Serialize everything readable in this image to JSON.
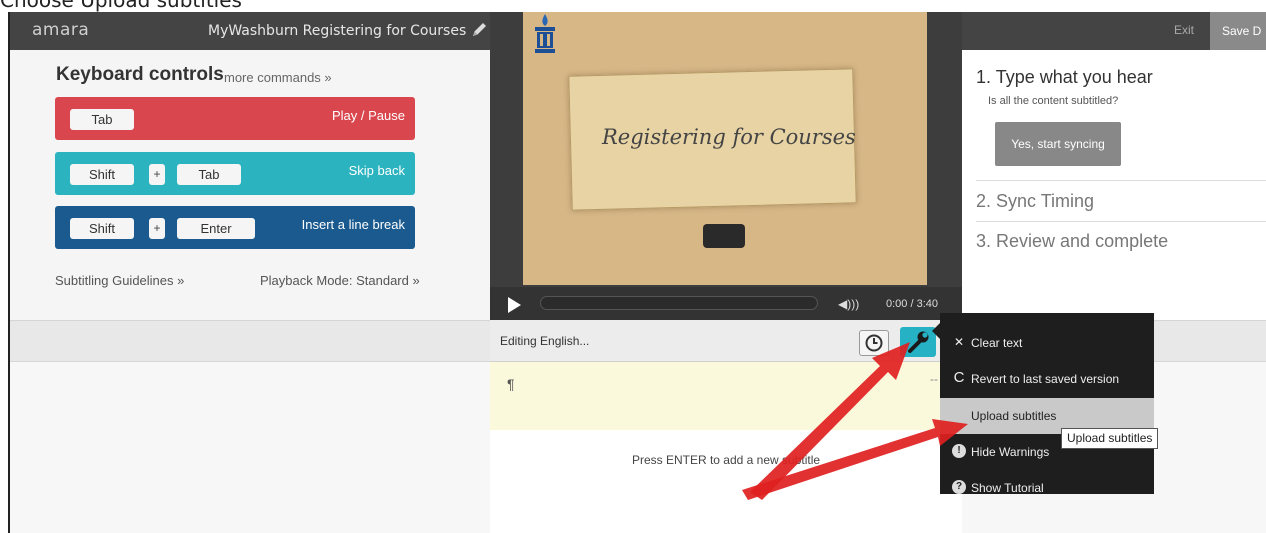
{
  "caption": "Choose Upload subtitles",
  "header": {
    "logo": "amara",
    "project_title": "MyWashburn Registering for Courses",
    "exit_label": "Exit",
    "save_label": "Save D"
  },
  "keyboard": {
    "title": "Keyboard controls",
    "more_link": "more commands »",
    "rows": [
      {
        "keys": [
          "Tab"
        ],
        "action": "Play / Pause"
      },
      {
        "keys": [
          "Shift",
          "+",
          "Tab"
        ],
        "action": "Skip back"
      },
      {
        "keys": [
          "Shift",
          "+",
          "Enter"
        ],
        "action": "Insert a line break"
      }
    ],
    "guidelines_link": "Subtitling Guidelines »",
    "playback_link": "Playback Mode: Standard »"
  },
  "video": {
    "slide_title": "Registering for Courses",
    "time": "0:00 / 3:40",
    "progress_fraction": 0
  },
  "steps": {
    "step1_title": "1. Type what you hear",
    "step1_question": "Is all the content subtitled?",
    "step1_button": "Yes, start syncing",
    "step2_title": "2. Sync Timing",
    "step3_title": "3. Review and complete"
  },
  "editor": {
    "editing_label": "Editing English...",
    "pilcrow": "¶",
    "row_dash": "--",
    "hint": "Press ENTER to add a new subtitle"
  },
  "menu": {
    "items": [
      {
        "icon": "close-icon",
        "glyph": "✕",
        "label": "Clear text"
      },
      {
        "icon": "revert-icon",
        "glyph": "C",
        "label": "Revert to last saved version"
      },
      {
        "icon": "",
        "glyph": "",
        "label": "Upload subtitles"
      },
      {
        "icon": "warning-icon",
        "glyph": "!",
        "label": "Hide Warnings"
      },
      {
        "icon": "help-icon",
        "glyph": "?",
        "label": "Show Tutorial"
      }
    ],
    "tooltip": "Upload subtitles"
  },
  "colors": {
    "play_pause": "#d9464e",
    "skip_back": "#2bb3bf",
    "line_break": "#1a5a8e",
    "wrench_button": "#27b1c4",
    "arrow": "#e02020"
  }
}
